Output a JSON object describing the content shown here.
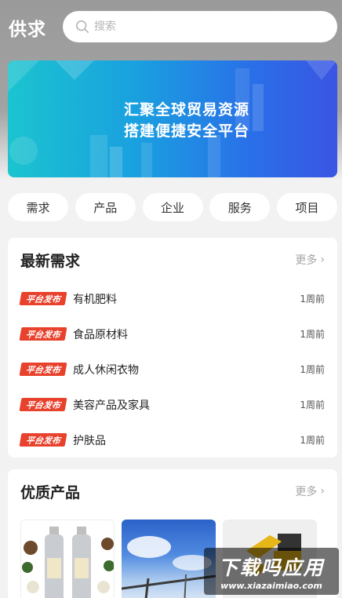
{
  "header": {
    "title": "供求",
    "search_placeholder": "搜索",
    "search_icon": "search-icon"
  },
  "banner": {
    "line1": "汇聚全球贸易资源",
    "line2": "搭建便捷安全平台"
  },
  "categories": [
    "需求",
    "产品",
    "企业",
    "服务",
    "项目"
  ],
  "demand": {
    "title": "最新需求",
    "more_label": "更多",
    "tag": "平台发布",
    "items": [
      {
        "title": "有机肥料",
        "time": "1周前"
      },
      {
        "title": "食品原材料",
        "time": "1周前"
      },
      {
        "title": "成人休闲衣物",
        "time": "1周前"
      },
      {
        "title": "美容产品及家具",
        "time": "1周前"
      },
      {
        "title": "护肤品",
        "time": "1周前"
      }
    ]
  },
  "products": {
    "title": "优质产品",
    "more_label": "更多"
  },
  "watermark": {
    "main": "下载吗应用",
    "sub": "www.xiazaimiao.com"
  },
  "colors": {
    "tag_red": "#e8412c",
    "banner_start": "#1bc4cf",
    "banner_end": "#3a55e3"
  }
}
